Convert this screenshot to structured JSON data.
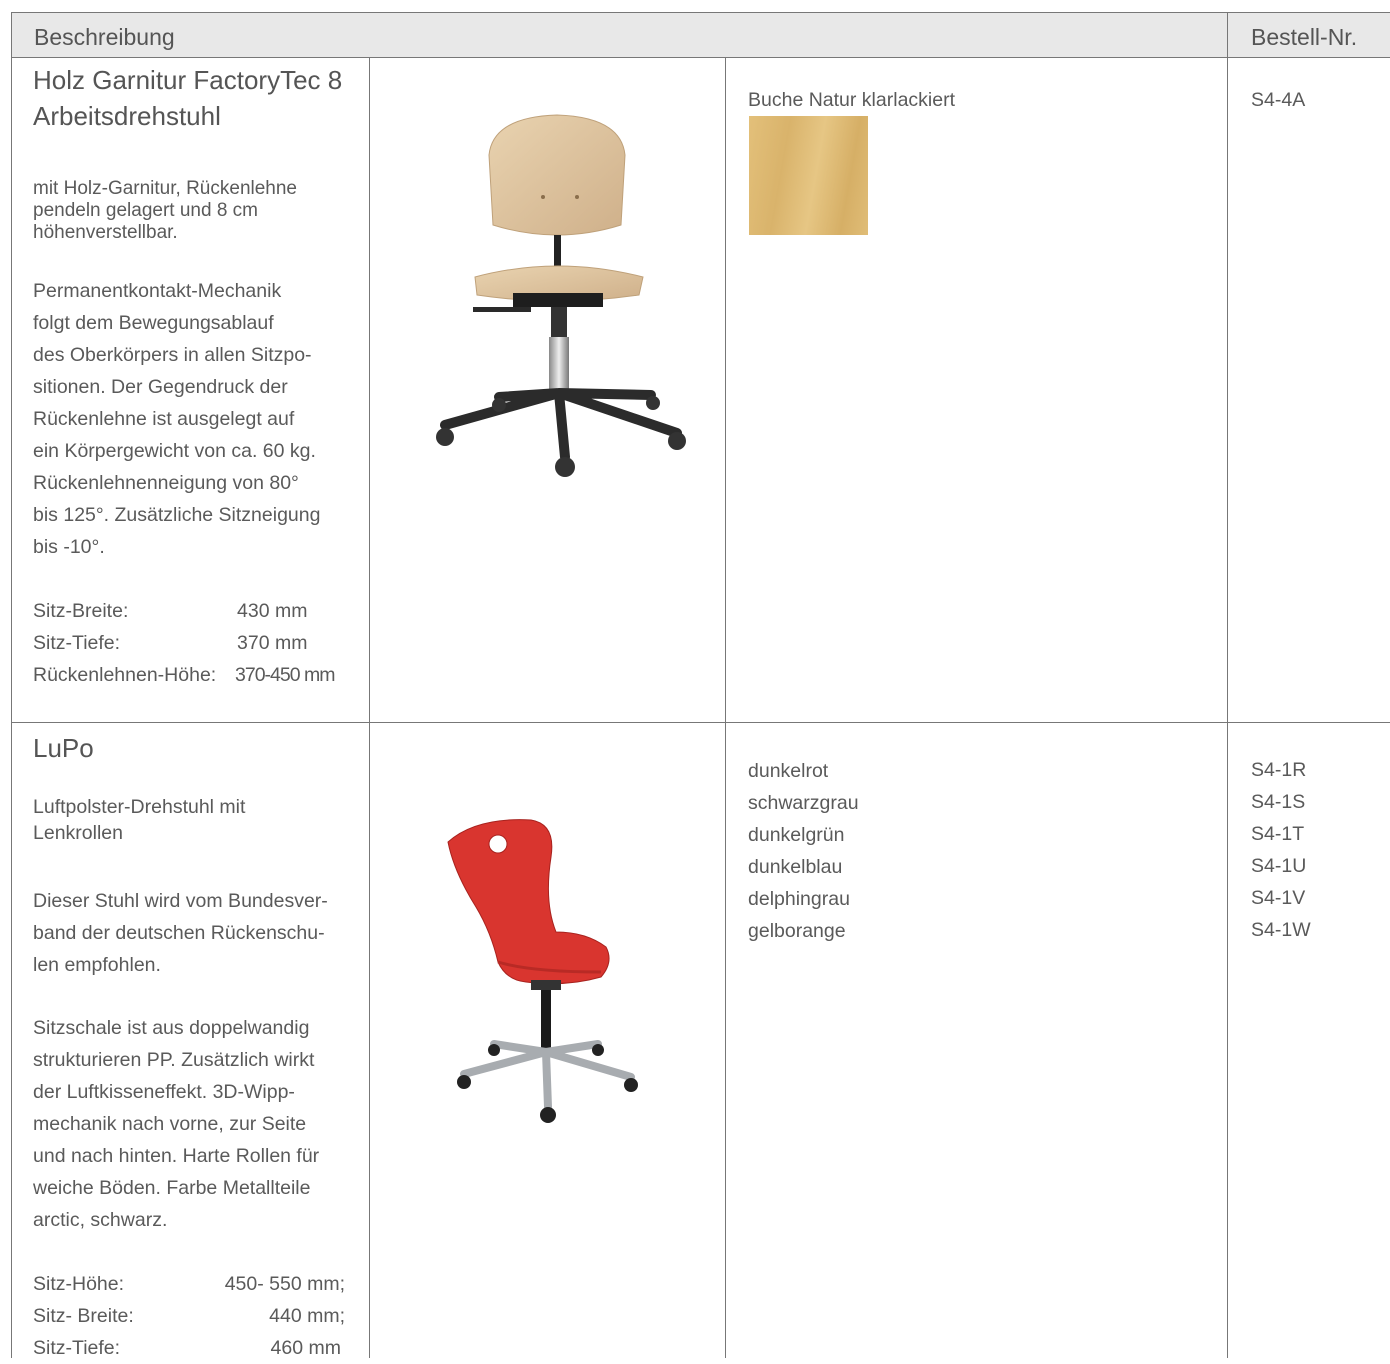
{
  "header": {
    "desc": "Beschreibung",
    "nr": "Bestell-Nr."
  },
  "p1": {
    "title1": "Holz Garnitur FactoryTec 8",
    "title2": "Arbeitsdrehstuhl",
    "intro": [
      "mit Holz-Garnitur, Rückenlehne",
      "pendeln gelagert und 8 cm",
      "höhenverstellbar."
    ],
    "body": [
      "Permanentkontakt-Mechanik",
      "folgt dem Bewegungsablauf",
      "des Oberkörpers in allen Sitzpo-",
      "sitionen. Der Gegendruck der",
      "Rückenlehne ist ausgelegt auf",
      "ein Körpergewicht von ca. 60 kg.",
      "Rückenlehnenneigung von 80°",
      "bis 125°. Zusätzliche Sitzneigung",
      "bis -10°."
    ],
    "specs": [
      {
        "label": "Sitz-Breite:",
        "value": "430 mm"
      },
      {
        "label": "Sitz-Tiefe:",
        "value": "370 mm"
      },
      {
        "label": "Rückenlehnen-Höhe:",
        "value": "370-450 mm"
      }
    ],
    "variant": "Buche Natur klarlackiert",
    "nr": "S4-4A"
  },
  "p2": {
    "title": "LuPo",
    "intro": [
      "Luftpolster-Drehstuhl mit",
      "Lenkrollen"
    ],
    "body1": [
      "Dieser Stuhl wird vom Bundesver-",
      "band der deutschen Rückenschu-",
      "len empfohlen."
    ],
    "body2": [
      "Sitzschale ist aus doppelwandig",
      "strukturieren PP. Zusätzlich wirkt",
      "der Luftkisseneffekt. 3D-Wipp-",
      "mechanik nach vorne, zur Seite",
      "und nach hinten. Harte Rollen für",
      "weiche Böden. Farbe Metallteile",
      "arctic, schwarz."
    ],
    "specs": [
      {
        "label": "Sitz-Höhe:",
        "value": "450- 550  mm;"
      },
      {
        "label": "Sitz- Breite:",
        "value": "440 mm;"
      },
      {
        "label": "Sitz-Tiefe:",
        "value": "460 mm"
      }
    ],
    "colors": [
      "dunkelrot",
      "schwarzgrau",
      "dunkelgrün",
      "dunkelblau",
      "delphingrau",
      "gelborange"
    ],
    "nrs": [
      "S4-1R",
      "S4-1S",
      "S4-1T",
      "S4-1U",
      "S4-1V",
      "S4-1W"
    ]
  }
}
